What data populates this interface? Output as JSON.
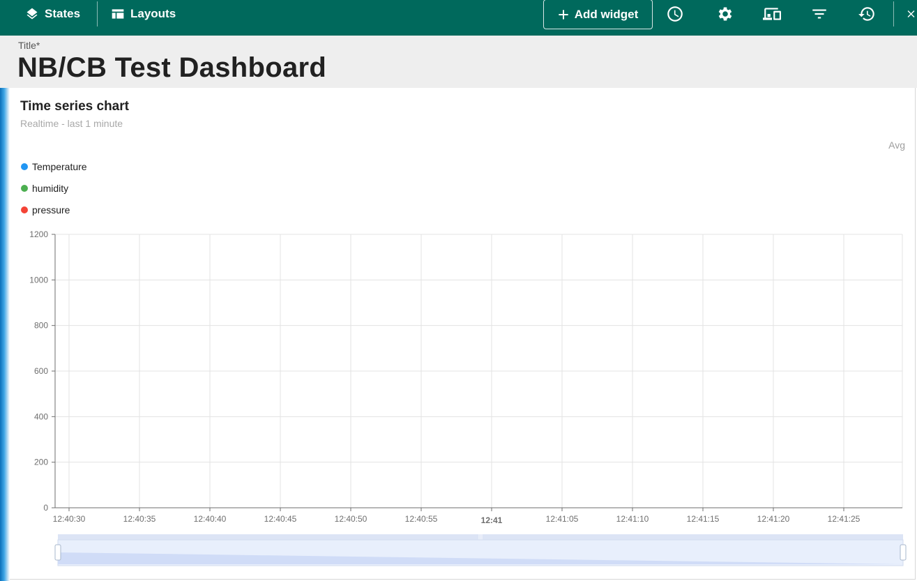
{
  "toolbar": {
    "states_label": "States",
    "layouts_label": "Layouts",
    "add_widget_label": "Add widget",
    "icons": [
      "layers-icon",
      "table-layout-icon",
      "plus-icon",
      "clock-icon",
      "gear-icon",
      "devices-icon",
      "filter-icon",
      "history-icon",
      "close-icon"
    ]
  },
  "title_area": {
    "label": "Title*",
    "value": "NB/CB Test Dashboard"
  },
  "widget": {
    "title": "Time series chart",
    "subtitle": "Realtime - last 1 minute",
    "legend_stat_header": "Avg"
  },
  "chart_data": {
    "type": "line",
    "series": [
      {
        "name": "Temperature",
        "color": "#2196f3",
        "values": []
      },
      {
        "name": "humidity",
        "color": "#4caf50",
        "values": []
      },
      {
        "name": "pressure",
        "color": "#f44336",
        "values": []
      }
    ],
    "x_ticks": [
      "12:40:30",
      "12:40:35",
      "12:40:40",
      "12:40:45",
      "12:40:50",
      "12:40:55",
      "12:41",
      "12:41:05",
      "12:41:10",
      "12:41:15",
      "12:41:20",
      "12:41:25"
    ],
    "x_tick_bold": "12:41",
    "y_ticks": [
      0,
      200,
      400,
      600,
      800,
      1000,
      1200
    ],
    "ylim": [
      0,
      1200
    ],
    "grid": true,
    "legend_position": "top-left",
    "data_zoom": true
  }
}
